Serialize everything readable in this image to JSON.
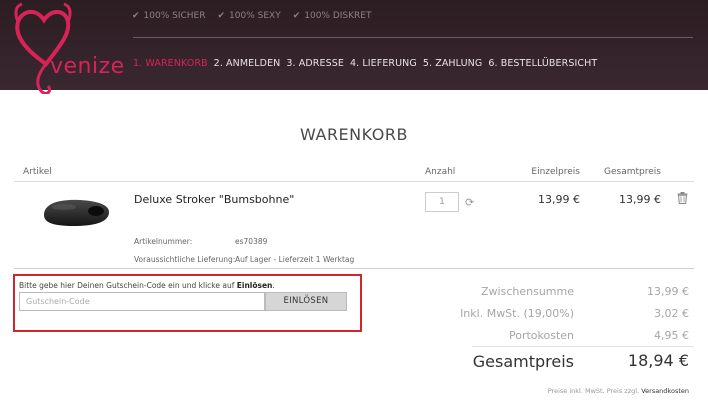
{
  "header": {
    "logo_text": "venize",
    "badges": [
      "100% SICHER",
      "100% SEXY",
      "100% DISKRET"
    ],
    "steps": [
      "1. WARENKORB",
      "2. ANMELDEN",
      "3. ADRESSE",
      "4. LIEFERUNG",
      "5. ZAHLUNG",
      "6. BESTELLÜBERSICHT"
    ],
    "active_step": 0,
    "brand_color": "#d8235a"
  },
  "page_title": "WARENKORB",
  "table": {
    "columns": {
      "article": "Artikel",
      "quantity": "Anzahl",
      "unit_price": "Einzelpreis",
      "total_price": "Gesamtpreis"
    }
  },
  "product": {
    "name": "Deluxe Stroker \"Bumsbohne\"",
    "article_number_label": "Artikelnummer:",
    "article_number": "es70389",
    "delivery_label": "Voraussichtliche Lieferung:",
    "delivery_value": "Auf Lager - Lieferzeit 1 Werktag",
    "quantity": "1",
    "unit_price": "13,99 €",
    "total_price": "13,99 €"
  },
  "coupon": {
    "prompt": "Bitte gebe hier Deinen Gutschein-Code ein und klicke auf",
    "prompt_bold": "Einlösen",
    "prompt_end": ".",
    "placeholder": "Gutschein-Code",
    "button_label": "EINLÖSEN",
    "highlight_color": "#d0262c"
  },
  "summary": {
    "subtotal_label": "Zwischensumme",
    "subtotal_value": "13,99 €",
    "vat_label": "Inkl. MwSt. (19,00%)",
    "vat_value": "3,02 €",
    "shipping_label": "Portokosten",
    "shipping_value": "4,95 €",
    "grand_label": "Gesamtpreis",
    "grand_value": "18,94 €",
    "footnote": "Preise inkl. MwSt. Preis zzgl.",
    "footnote_link": "Versandkosten"
  }
}
